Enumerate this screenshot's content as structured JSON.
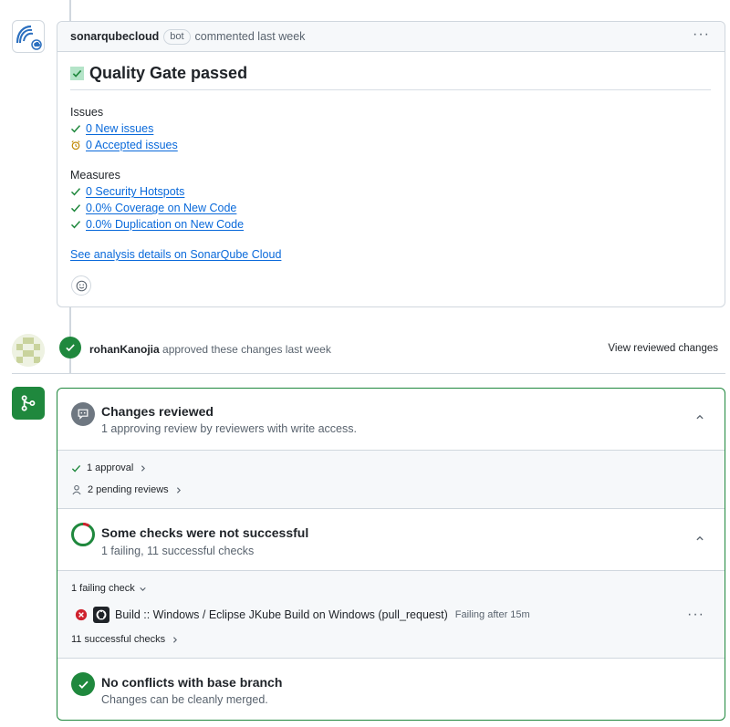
{
  "comment": {
    "author": "sonarqubecloud",
    "badge": "bot",
    "meta": "commented last week",
    "more": "···",
    "title": "Quality Gate passed",
    "issues_label": "Issues",
    "issues": [
      {
        "text": "0 New issues",
        "icon": "check-icon"
      },
      {
        "text": "0 Accepted issues",
        "icon": "alarm-clock-icon"
      }
    ],
    "measures_label": "Measures",
    "measures": [
      {
        "text": "0 Security Hotspots",
        "icon": "check-icon"
      },
      {
        "text": "0.0% Coverage on New Code",
        "icon": "check-icon"
      },
      {
        "text": "0.0% Duplication on New Code",
        "icon": "check-icon"
      }
    ],
    "details_link": "See analysis details on SonarQube Cloud"
  },
  "approval": {
    "user": "rohanKanojia",
    "text": "approved these changes last week",
    "view_link": "View reviewed changes"
  },
  "merge": {
    "reviewed_title": "Changes reviewed",
    "reviewed_sub": "1 approving review by reviewers with write access.",
    "approval_count": "1 approval",
    "pending_reviews": "2 pending reviews",
    "checks_title": "Some checks were not successful",
    "checks_sub": "1 failing, 11 successful checks",
    "failing_label": "1 failing check",
    "failing_check_name": "Build :: Windows / Eclipse JKube Build on Windows (pull_request)",
    "failing_check_status": "Failing after 15m",
    "failing_more": "···",
    "successful_label": "11 successful checks",
    "conflict_title": "No conflicts with base branch",
    "conflict_sub": "Changes can be cleanly merged."
  },
  "colors": {
    "success": "#1f883d",
    "danger": "#cf222e",
    "link": "#0969da",
    "muted": "#59636e",
    "warning": "#9a6700"
  }
}
